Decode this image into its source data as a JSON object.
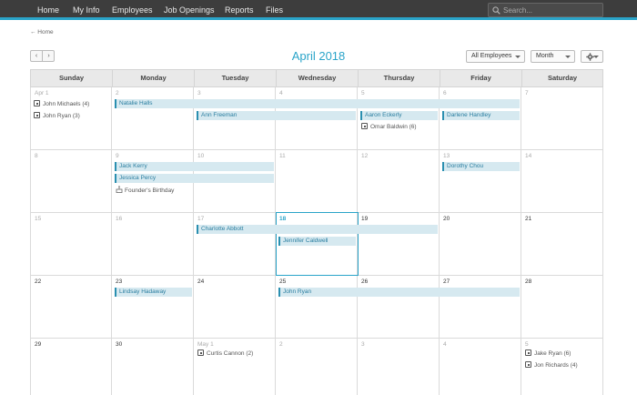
{
  "nav": {
    "items": [
      "Home",
      "My Info",
      "Employees",
      "Job Openings",
      "Reports",
      "Files"
    ],
    "search_placeholder": "Search..."
  },
  "breadcrumb": "← Home",
  "toolbar": {
    "prev_icon": "‹",
    "next_icon": "›",
    "month_title": "April 2018",
    "filter_label": "All Employees",
    "view_label": "Month"
  },
  "calendar": {
    "days_of_week": [
      "Sunday",
      "Monday",
      "Tuesday",
      "Wednesday",
      "Thursday",
      "Friday",
      "Saturday"
    ],
    "weeks": [
      [
        "Apr 1",
        "2",
        "3",
        "4",
        "5",
        "6",
        "7"
      ],
      [
        "8",
        "9",
        "10",
        "11",
        "12",
        "13",
        "14"
      ],
      [
        "15",
        "16",
        "17",
        "18",
        "19",
        "20",
        "21"
      ],
      [
        "22",
        "23",
        "24",
        "25",
        "26",
        "27",
        "28"
      ],
      [
        "29",
        "30",
        "May 1",
        "2",
        "3",
        "4",
        "5"
      ]
    ],
    "events": {
      "john_michaels": "John Michaels (4)",
      "john_ryan_3": "John Ryan (3)",
      "natalie_halls": "Natalie Halls",
      "ann_freeman": "Ann Freeman",
      "aaron_eckerly": "Aaron Eckerly",
      "darlene_handley": "Darlene Handley",
      "omar_baldwin": "Omar Baldwin (6)",
      "jack_kerry": "Jack Kerry",
      "jessica_percy": "Jessica Percy",
      "founders_birthday": "Founder's Birthday",
      "dorothy_chou": "Dorothy Chou",
      "charlotte_abbott": "Charlotte Abbott",
      "jennifer_caldwell": "Jennifer Caldwell",
      "lindsay_hadaway": "Lindsay Hadaway",
      "john_ryan": "John Ryan",
      "curtis_cannon": "Curtis Cannon (2)",
      "jake_ryan": "Jake Ryan (6)",
      "jon_richards": "Jon Richards (4)"
    }
  },
  "colors": {
    "accent": "#2aa4c9",
    "nav_bg": "#3d3d3d",
    "event_bg": "#d6e9f0"
  }
}
